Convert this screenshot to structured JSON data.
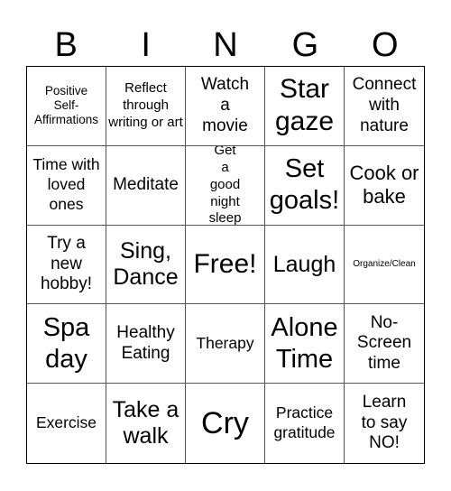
{
  "header": [
    "B",
    "I",
    "N",
    "G",
    "O"
  ],
  "cells": [
    "Positive Self-Affirmations",
    "Reflect through writing or art",
    "Watch a movie",
    "Star gaze",
    "Connect with nature",
    "Time with loved ones",
    "Meditate",
    "Get a good night sleep",
    "Set goals!",
    "Cook or bake",
    "Try a new hobby!",
    "Sing, Dance",
    "Free!",
    "Laugh",
    "Organize/Clean",
    "Spa day",
    "Healthy Eating",
    "Therapy",
    "Alone Time",
    "No-Screen time",
    "Exercise",
    "Take a walk",
    "Cry",
    "Practice gratitude",
    "Learn to say NO!"
  ]
}
